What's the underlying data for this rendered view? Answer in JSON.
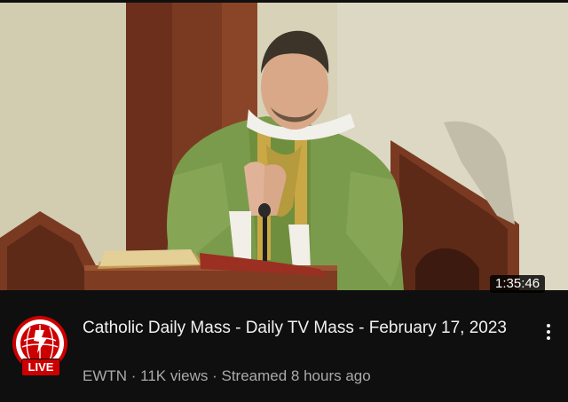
{
  "video": {
    "duration": "1:35:46",
    "title": "Catholic Daily Mass - Daily TV Mass - February 17, 2023",
    "channel": "EWTN",
    "views": "11K views",
    "streamed": "Streamed 8 hours ago",
    "separator": " · ",
    "live_label": "LIVE"
  },
  "icons": {
    "avatar": "ewtn-logo-icon",
    "menu": "more-vert-icon"
  },
  "colors": {
    "background": "#0f0f0f",
    "live": "#cc0000",
    "title": "#f1f1f1",
    "meta": "#aaaaaa"
  }
}
